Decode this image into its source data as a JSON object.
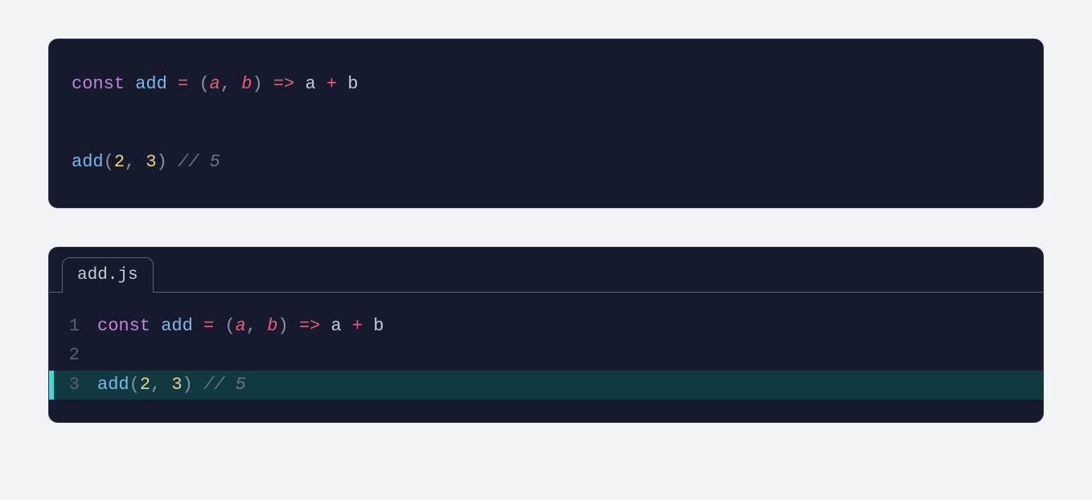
{
  "block1": {
    "line1": {
      "keyword": "const",
      "space1": " ",
      "name": "add",
      "space2": " ",
      "equals": "=",
      "space3": " ",
      "paren_open": "(",
      "param_a": "a",
      "comma": ",",
      "space4": " ",
      "param_b": "b",
      "paren_close": ")",
      "space5": " ",
      "arrow": "=>",
      "space6": " ",
      "expr_a": "a",
      "space7": " ",
      "plus": "+",
      "space8": " ",
      "expr_b": "b"
    },
    "line3": {
      "fn": "add",
      "paren_open": "(",
      "arg1": "2",
      "comma": ",",
      "space1": " ",
      "arg2": "3",
      "paren_close": ")",
      "space2": " ",
      "comment": "// 5"
    }
  },
  "block2": {
    "tab_label": "add.js",
    "line_numbers": {
      "n1": "1",
      "n2": "2",
      "n3": "3"
    },
    "line1": {
      "keyword": "const",
      "space1": " ",
      "name": "add",
      "space2": " ",
      "equals": "=",
      "space3": " ",
      "paren_open": "(",
      "param_a": "a",
      "comma": ",",
      "space4": " ",
      "param_b": "b",
      "paren_close": ")",
      "space5": " ",
      "arrow": "=>",
      "space6": " ",
      "expr_a": "a",
      "space7": " ",
      "plus": "+",
      "space8": " ",
      "expr_b": "b"
    },
    "line3": {
      "fn": "add",
      "paren_open": "(",
      "arg1": "2",
      "comma": ",",
      "space1": " ",
      "arg2": "3",
      "paren_close": ")",
      "space2": " ",
      "comment": "// 5"
    }
  }
}
